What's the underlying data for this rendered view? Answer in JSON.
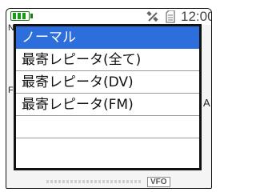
{
  "status_bar": {
    "time": "12:00",
    "battery_icon": "battery-full-icon",
    "gps_icon": "satellite-icon",
    "sd_icon": "sd-card-icon"
  },
  "background": {
    "left_letter_top": "N",
    "left_letter_mid": "F",
    "right_letter": "A",
    "mode_badge": "VFO"
  },
  "menu": {
    "items": [
      {
        "label": "ノーマル",
        "selected": true
      },
      {
        "label": "最寄レピータ(全て)",
        "selected": false
      },
      {
        "label": "最寄レピータ(DV)",
        "selected": false
      },
      {
        "label": "最寄レピータ(FM)",
        "selected": false
      },
      {
        "label": "",
        "selected": false
      },
      {
        "label": "",
        "selected": false
      }
    ]
  },
  "colors": {
    "selection": "#2c6fdc",
    "battery": "#1a9a1a"
  }
}
